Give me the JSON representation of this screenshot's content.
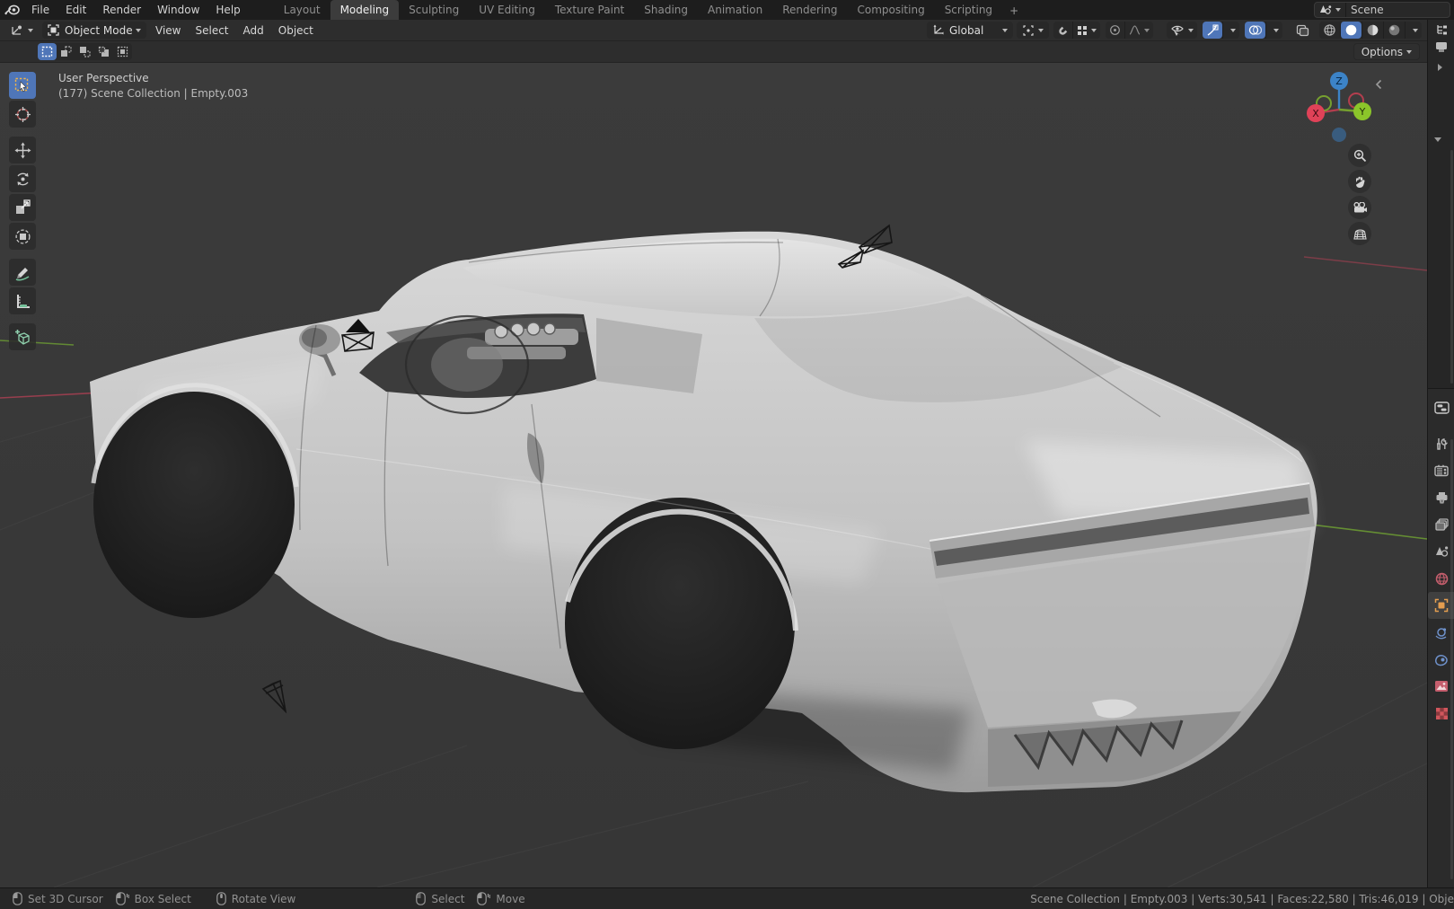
{
  "topbar": {
    "menus": [
      "File",
      "Edit",
      "Render",
      "Window",
      "Help"
    ],
    "workspaces": [
      "Layout",
      "Modeling",
      "Sculpting",
      "UV Editing",
      "Texture Paint",
      "Shading",
      "Animation",
      "Rendering",
      "Compositing",
      "Scripting"
    ],
    "active_workspace": "Modeling",
    "add_workspace": "+",
    "scene_field": "Scene"
  },
  "header": {
    "mode": "Object Mode",
    "menus": [
      "View",
      "Select",
      "Add",
      "Object"
    ],
    "orientation": "Global",
    "options": "Options"
  },
  "viewport": {
    "overlay_line1": "User Perspective",
    "overlay_line2": "(177) Scene Collection | Empty.003",
    "gizmo_axes": {
      "x": "X",
      "y": "Y",
      "z": "Z"
    }
  },
  "statusbar": {
    "hints": [
      {
        "icon": "mouse-left",
        "label": "Set 3D Cursor"
      },
      {
        "icon": "mouse-left-drag",
        "label": "Box Select"
      },
      {
        "icon": "mouse-middle",
        "label": "Rotate View"
      },
      {
        "icon": "mouse-left",
        "label": "Select"
      },
      {
        "icon": "mouse-left-drag",
        "label": "Move"
      }
    ],
    "stats": "Scene Collection | Empty.003 | Verts:30,541 | Faces:22,580 | Tris:46,019 | Obje"
  },
  "tools_left": [
    "select-box",
    "cursor",
    "move",
    "rotate",
    "scale",
    "transform",
    "annotate",
    "measure",
    "add-cube"
  ],
  "properties_tabs": [
    "tool",
    "render",
    "output",
    "view-layer",
    "scene",
    "world",
    "object",
    "physics",
    "constraints",
    "data",
    "texture"
  ],
  "colors": {
    "accent_blue": "#4f76b8",
    "axis_x_red": "#b33e4e",
    "axis_y_green": "#76a02f",
    "axis_z_blue": "#3c83c7",
    "object_tab_orange": "#e39d50",
    "world_tab_pink": "#c55e6d"
  }
}
